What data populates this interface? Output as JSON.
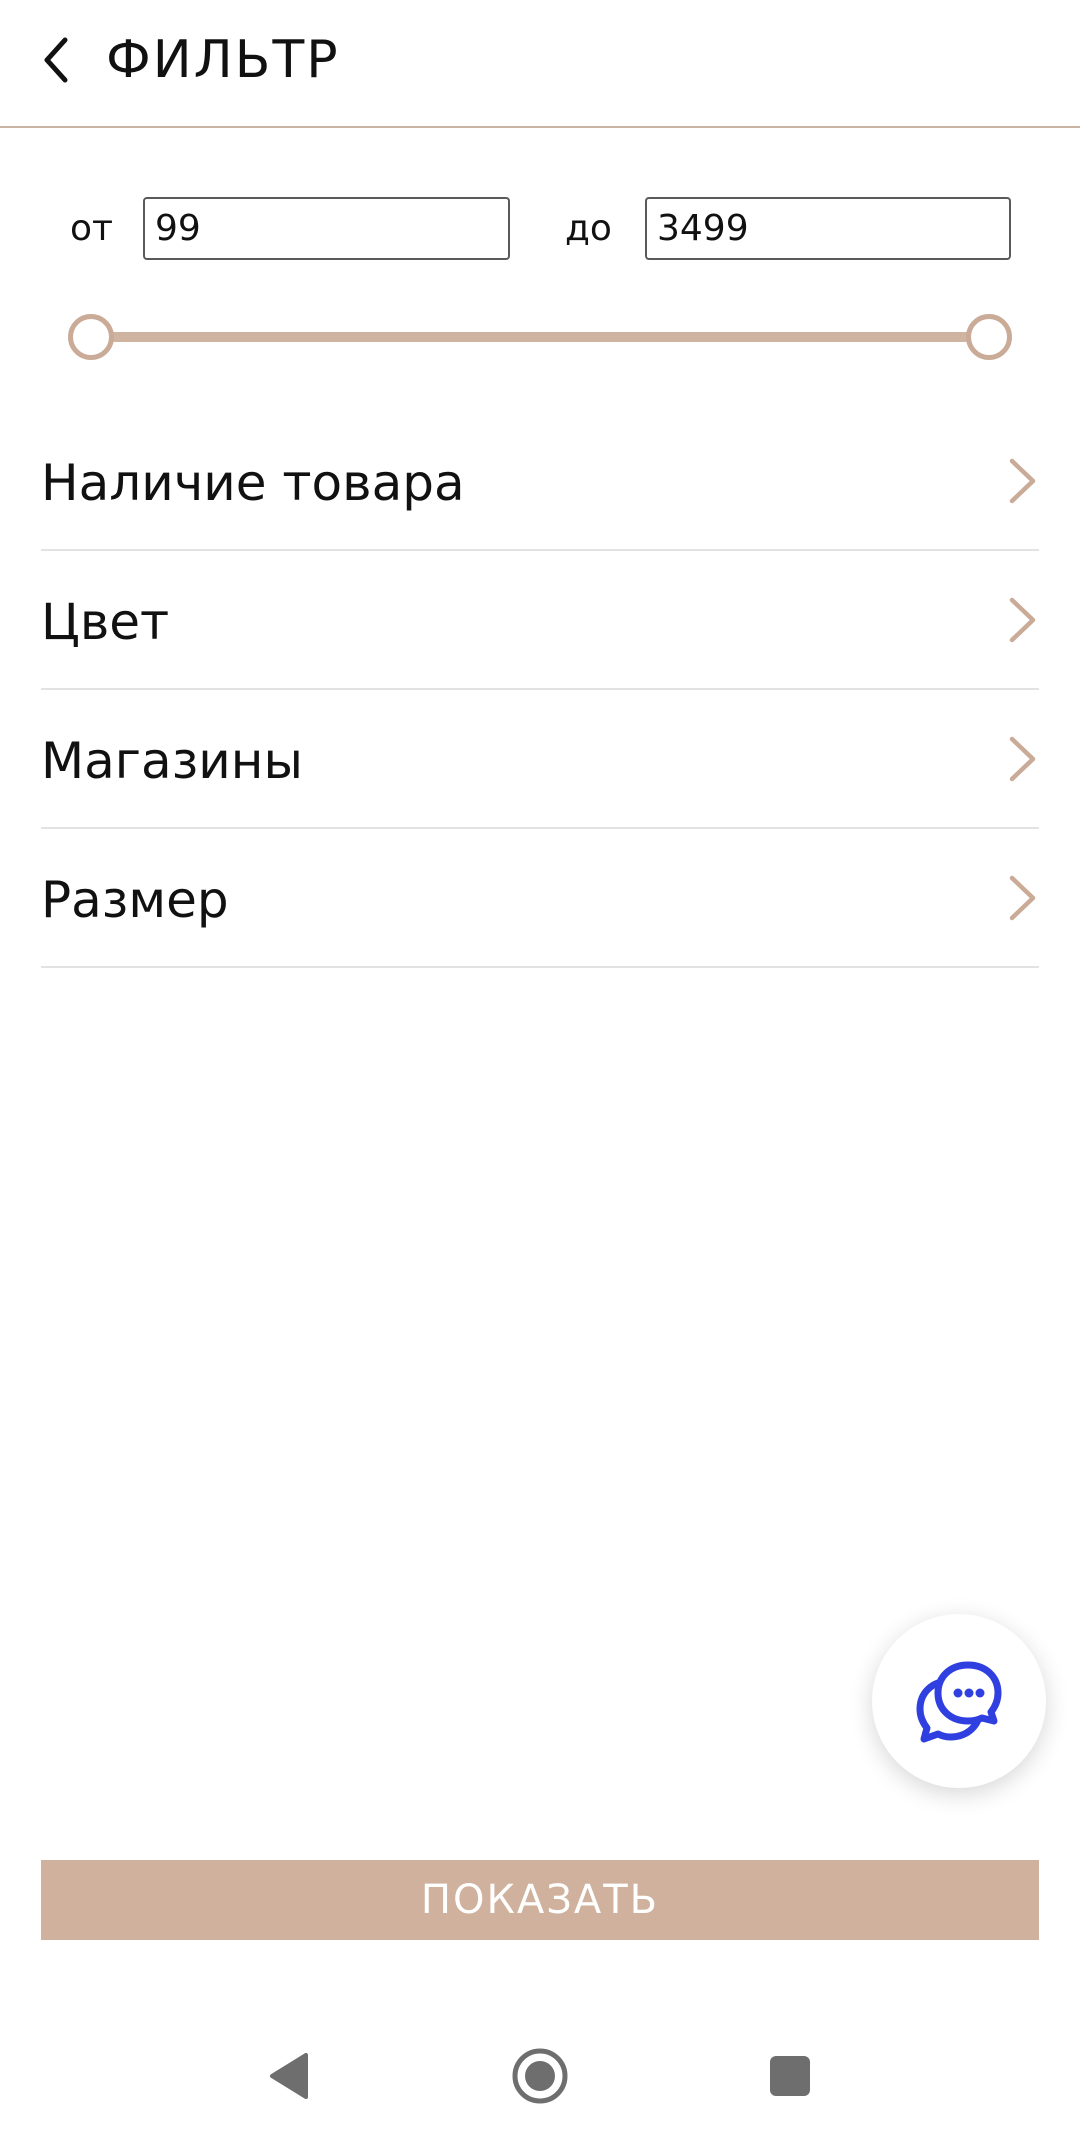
{
  "header": {
    "title": "ФИЛЬТР"
  },
  "price": {
    "from_label": "от",
    "from_value": "99",
    "to_label": "до",
    "to_value": "3499",
    "slider_min_fraction": 0.0,
    "slider_max_fraction": 1.0
  },
  "filters": [
    {
      "label": "Наличие товара"
    },
    {
      "label": "Цвет"
    },
    {
      "label": "Магазины"
    },
    {
      "label": "Размер"
    }
  ],
  "actions": {
    "show_label": "ПОКАЗАТЬ"
  },
  "icons": {
    "back": "chevron-left-icon",
    "row_chevron": "chevron-right-icon",
    "chat": "chat-bubbles-icon",
    "nav_back": "triangle-back-icon",
    "nav_home": "circle-home-icon",
    "nav_recents": "square-recents-icon"
  },
  "colors": {
    "accent": "#cfb19d",
    "chevron": "#c9ab97",
    "chat_icon": "#2f3fe0",
    "divider": "#e2e2e2",
    "header_border": "#c9b3a3"
  }
}
